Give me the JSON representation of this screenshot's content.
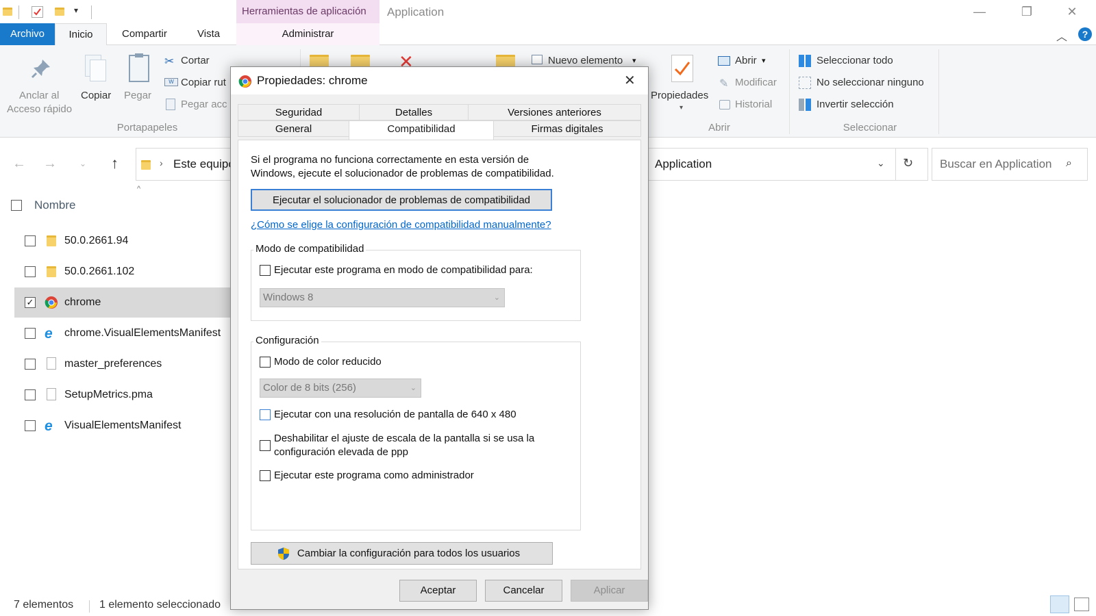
{
  "titlebar": {
    "contextual_tab": "Herramientas de aplicación",
    "app_title": "Application",
    "win_min": "—",
    "win_max": "❐",
    "win_close": "✕"
  },
  "menu": {
    "archivo": "Archivo",
    "inicio": "Inicio",
    "compartir": "Compartir",
    "vista": "Vista",
    "administrar": "Administrar",
    "help": "?"
  },
  "ribbon": {
    "anclar_1": "Anclar al",
    "anclar_2": "Acceso rápido",
    "copiar": "Copiar",
    "pegar": "Pegar",
    "cortar": "Cortar",
    "copiar_ruta": "Copiar rut",
    "pegar_acceso": "Pegar acc",
    "portapapeles": "Portapapeles",
    "nuevo_elemento": "Nuevo elemento",
    "propiedades": "Propiedades",
    "abrir": "Abrir",
    "modificar": "Modificar",
    "historial": "Historial",
    "abrir_group": "Abrir",
    "seleccionar_todo": "Seleccionar todo",
    "no_seleccionar": "No seleccionar ninguno",
    "invertir": "Invertir selección",
    "seleccionar_group": "Seleccionar"
  },
  "address": {
    "breadcrumb_start": "Este equipo",
    "current": "Application",
    "search_placeholder": "Buscar en Application"
  },
  "filelist": {
    "column_name": "Nombre",
    "items": [
      {
        "name": "50.0.2661.94",
        "type": "folder",
        "checked": false
      },
      {
        "name": "50.0.2661.102",
        "type": "folder",
        "checked": false
      },
      {
        "name": "chrome",
        "type": "chrome",
        "checked": true
      },
      {
        "name": "chrome.VisualElementsManifest",
        "type": "ie",
        "checked": false
      },
      {
        "name": "master_preferences",
        "type": "file",
        "checked": false
      },
      {
        "name": "SetupMetrics.pma",
        "type": "file",
        "checked": false
      },
      {
        "name": "VisualElementsManifest",
        "type": "ie",
        "checked": false
      }
    ]
  },
  "status": {
    "count": "7 elementos",
    "selected": "1 elemento seleccionado"
  },
  "dialog": {
    "title": "Propiedades: chrome",
    "tabs_back": [
      "Seguridad",
      "Detalles",
      "Versiones anteriores"
    ],
    "tabs_front": [
      "General",
      "Compatibilidad",
      "Firmas digitales"
    ],
    "intro_1": "Si el programa no funciona correctamente en esta versión de",
    "intro_2": "Windows, ejecute el solucionador de problemas de compatibilidad.",
    "troubleshooter_button": "Ejecutar el solucionador de problemas de compatibilidad",
    "manual_link": "¿Cómo se elige la configuración de compatibilidad manualmente?",
    "compat_group": "Modo de compatibilidad",
    "compat_check": "Ejecutar este programa en modo de compatibilidad para:",
    "compat_select": "Windows 8",
    "config_group": "Configuración",
    "reduced_color": "Modo de color reducido",
    "color_select": "Color de 8 bits (256)",
    "res_640": "Ejecutar con una resolución de pantalla de 640 x 480",
    "dpi_1": "Deshabilitar el ajuste de escala de la pantalla si se usa la",
    "dpi_2": "configuración elevada de ppp",
    "admin": "Ejecutar este programa como administrador",
    "all_users_button": "Cambiar la configuración para todos los usuarios",
    "ok": "Aceptar",
    "cancel": "Cancelar",
    "apply": "Aplicar"
  },
  "colors": {
    "accent": "#1979ca",
    "context_tab": "#f3ddf1",
    "link": "#0066cc",
    "selected_row": "#d9d9d9"
  }
}
